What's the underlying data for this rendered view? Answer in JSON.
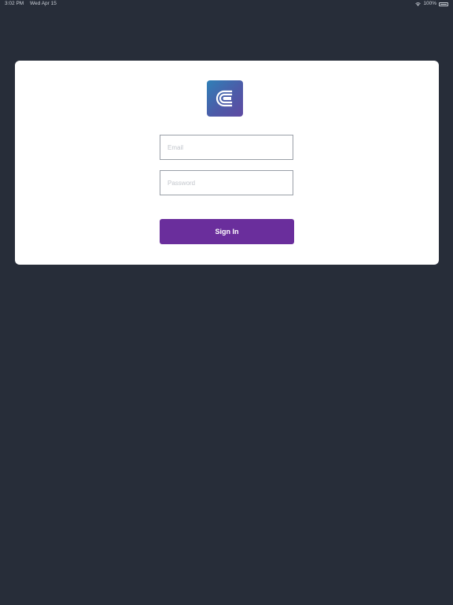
{
  "status_bar": {
    "time": "3:02 PM",
    "date": "Wed Apr 15",
    "battery": "100%",
    "icons": [
      "wifi-icon",
      "battery-icon"
    ]
  },
  "login": {
    "logo_icon": "app-logo-icon",
    "email_placeholder": "Email",
    "password_placeholder": "Password",
    "sign_in_label": "Sign In"
  },
  "colors": {
    "background": "#272d39",
    "card": "#ffffff",
    "accent": "#6a2e9c",
    "logo_gradient_start": "#2f80b7",
    "logo_gradient_end": "#5f4aa2"
  }
}
